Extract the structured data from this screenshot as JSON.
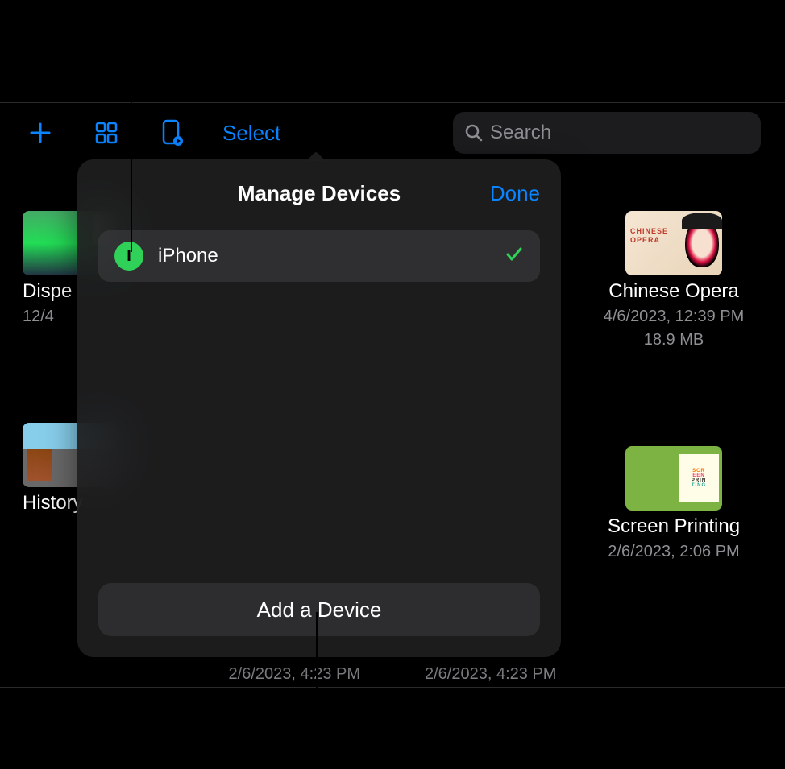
{
  "toolbar": {
    "select_label": "Select",
    "search_placeholder": "Search"
  },
  "popover": {
    "title": "Manage Devices",
    "done_label": "Done",
    "device": {
      "badge_letter": "I",
      "name": "iPhone"
    },
    "add_label": "Add a Device"
  },
  "grid": {
    "left": [
      {
        "title": "Dispe",
        "date": "12/4"
      },
      {
        "title": "History",
        "date": ""
      }
    ],
    "right": [
      {
        "title": "Chinese Opera",
        "date": "4/6/2023, 12:39 PM",
        "size": "18.9 MB"
      },
      {
        "title": "Screen Printing",
        "date": "2/6/2023, 2:06 PM",
        "size": ""
      }
    ],
    "mid_dates": [
      "2/6/2023, 4:23 PM",
      "2/6/2023, 4:23 PM"
    ]
  }
}
